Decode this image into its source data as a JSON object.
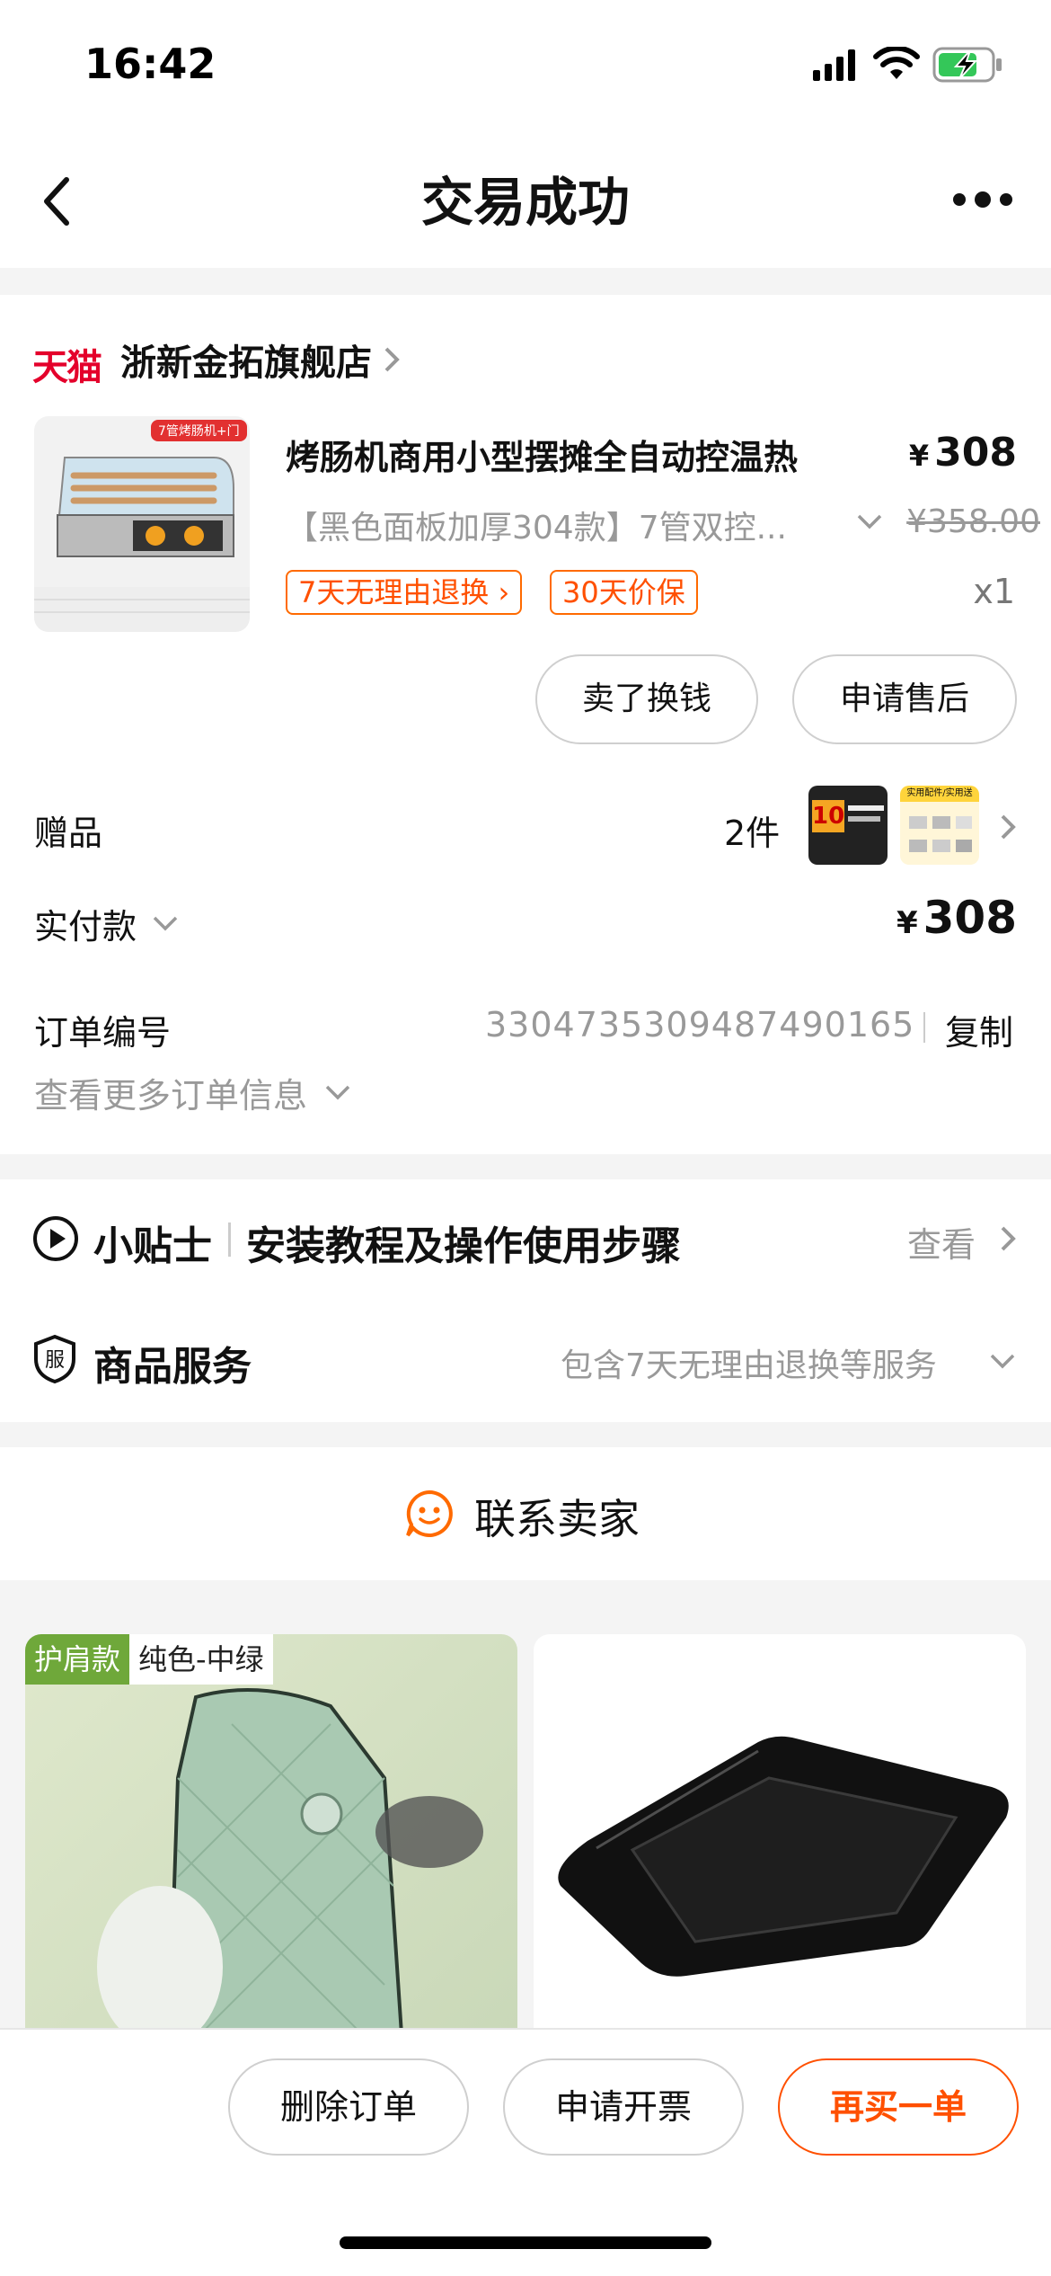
{
  "status": {
    "time": "16:42"
  },
  "nav": {
    "title": "交易成功"
  },
  "shop": {
    "brand": "天猫",
    "name": "浙新金拓旗舰店"
  },
  "product": {
    "thumb_caption": "7管烤肠机+门",
    "title": "烤肠机商用小型摆摊全自动控温热",
    "price_symbol": "¥",
    "price": "308",
    "spec": "【黑色面板加厚304款】7管双控...",
    "original_price": "¥358.00",
    "tag1": "7天无理由退换 ›",
    "tag2": "30天价保",
    "qty": "x1",
    "btn_sell": "卖了换钱",
    "btn_aftersale": "申请售后"
  },
  "gift": {
    "label": "赠品",
    "count": "2件",
    "gift1_badge": "10",
    "gift2_caption": "实用配件/实用送"
  },
  "payment": {
    "label": "实付款",
    "symbol": "¥",
    "amount": "308"
  },
  "order": {
    "label": "订单编号",
    "number": "3304735309487490165",
    "copy": "复制",
    "more": "查看更多订单信息"
  },
  "tips": {
    "title": "小贴士",
    "desc": "安装教程及操作使用步骤",
    "action": "查看"
  },
  "service": {
    "icon_char": "服",
    "title": "商品服务",
    "desc": "包含7天无理由退换等服务"
  },
  "contact": {
    "label": "联系卖家"
  },
  "recommend": {
    "badge": "护肩款",
    "variant": "纯色-中绿"
  },
  "bottom": {
    "delete": "删除订单",
    "invoice": "申请开票",
    "rebuy": "再买一单"
  }
}
